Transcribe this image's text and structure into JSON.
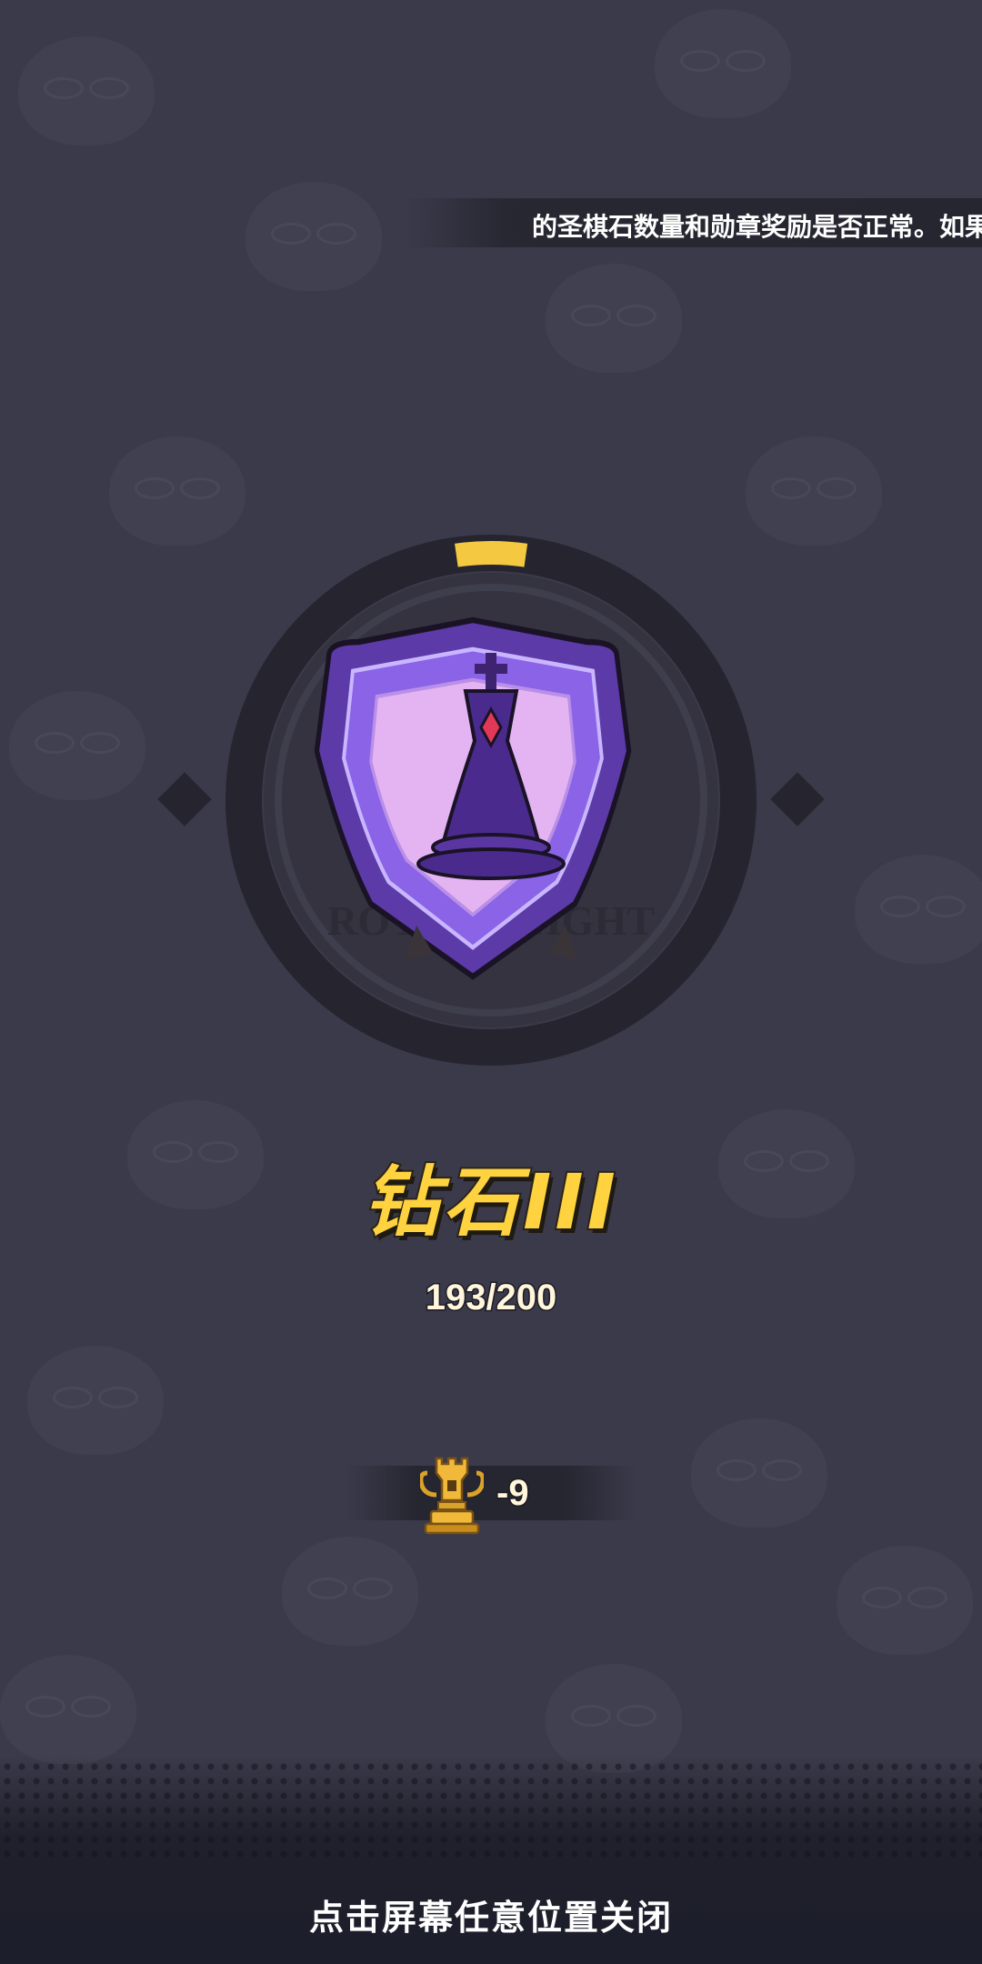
{
  "notice": {
    "ticker_text": "的圣棋石数量和勋章奖励是否正常。如果"
  },
  "rank": {
    "name": "钻石III",
    "points_current": 193,
    "points_max": 200,
    "progress_text": "193/200",
    "badge_watermark": "ROYAL KNIGHT",
    "badge_icon": "king-chess-piece-shield-icon",
    "progress_color": "#f5c842"
  },
  "trophy_change": {
    "value_text": "-9",
    "icon": "rook-trophy-icon"
  },
  "footer": {
    "close_hint": "点击屏幕任意位置关闭"
  },
  "colors": {
    "background": "#3b3a4a",
    "rank_text": "#ffd23f",
    "ring": "#25242f",
    "badge_purple": "#7b4fd6"
  }
}
